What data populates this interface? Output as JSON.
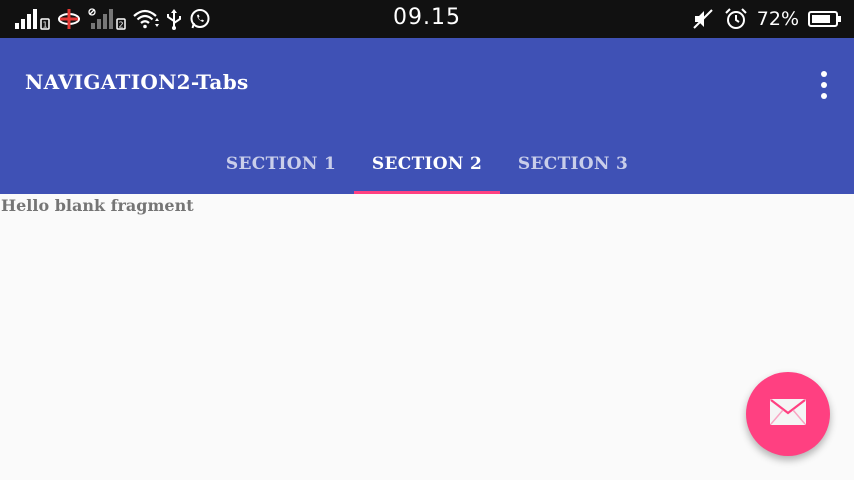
{
  "status_bar": {
    "time": "09.15",
    "battery_percent": "72%",
    "left_icons": [
      "signal-sim1-icon",
      "no-data-icon",
      "signal-sim2-icon",
      "wifi-icon",
      "usb-icon",
      "whatsapp-icon"
    ],
    "right_icons": [
      "mute-icon",
      "alarm-icon",
      "battery-icon"
    ]
  },
  "app_bar": {
    "title": "NAVIGATION2-Tabs",
    "overflow_icon": "more-vert-icon",
    "color": "#3f51b5"
  },
  "tabs": [
    {
      "label": "SECTION 1",
      "selected": false
    },
    {
      "label": "SECTION 2",
      "selected": true
    },
    {
      "label": "SECTION 3",
      "selected": false
    }
  ],
  "indicator_color": "#ff4081",
  "content": {
    "text": "Hello blank fragment"
  },
  "fab": {
    "icon": "email-icon",
    "color": "#ff4081"
  }
}
